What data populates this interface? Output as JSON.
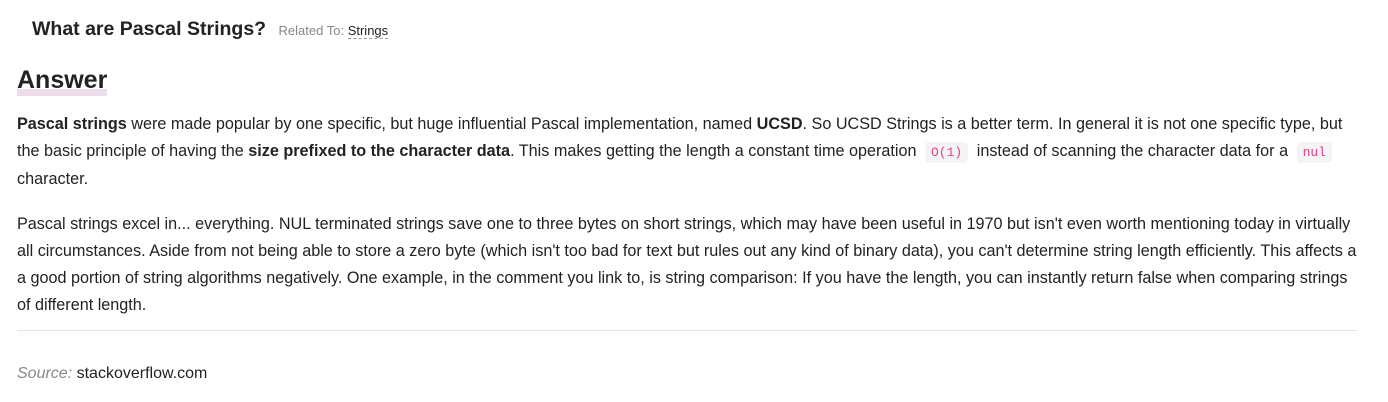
{
  "question": {
    "title": "What are Pascal Strings?",
    "related_label": "Related To:",
    "related_link": "Strings"
  },
  "answer_heading": "Answer",
  "p1": {
    "t1": "Pascal strings",
    "t2": " were made popular by one specific, but huge influential Pascal implementation, named ",
    "t3": "UCSD",
    "t4": ". So UCSD Strings is a better term. In general it is not one specific type, but the basic principle of having the ",
    "t5": "size prefixed to the character data",
    "t6": ". This makes getting the length a constant time operation",
    "code1": "O(1)",
    "t7": "instead of scanning the character data for a",
    "code2": "nul",
    "t8": "character."
  },
  "p2": "Pascal strings excel in... everything. NUL terminated strings save one to three bytes on short strings, which may have been useful in 1970 but isn't even worth mentioning today in virtually all circumstances. Aside from not being able to store a zero byte (which isn't too bad for text but rules out any kind of binary data), you can't determine string length efficiently. This affects a a good portion of string algorithms negatively. One example, in the comment you link to, is string comparison: If you have the length, you can instantly return false when comparing strings of different length.",
  "source": {
    "label": "Source:",
    "value": "stackoverflow.com"
  }
}
